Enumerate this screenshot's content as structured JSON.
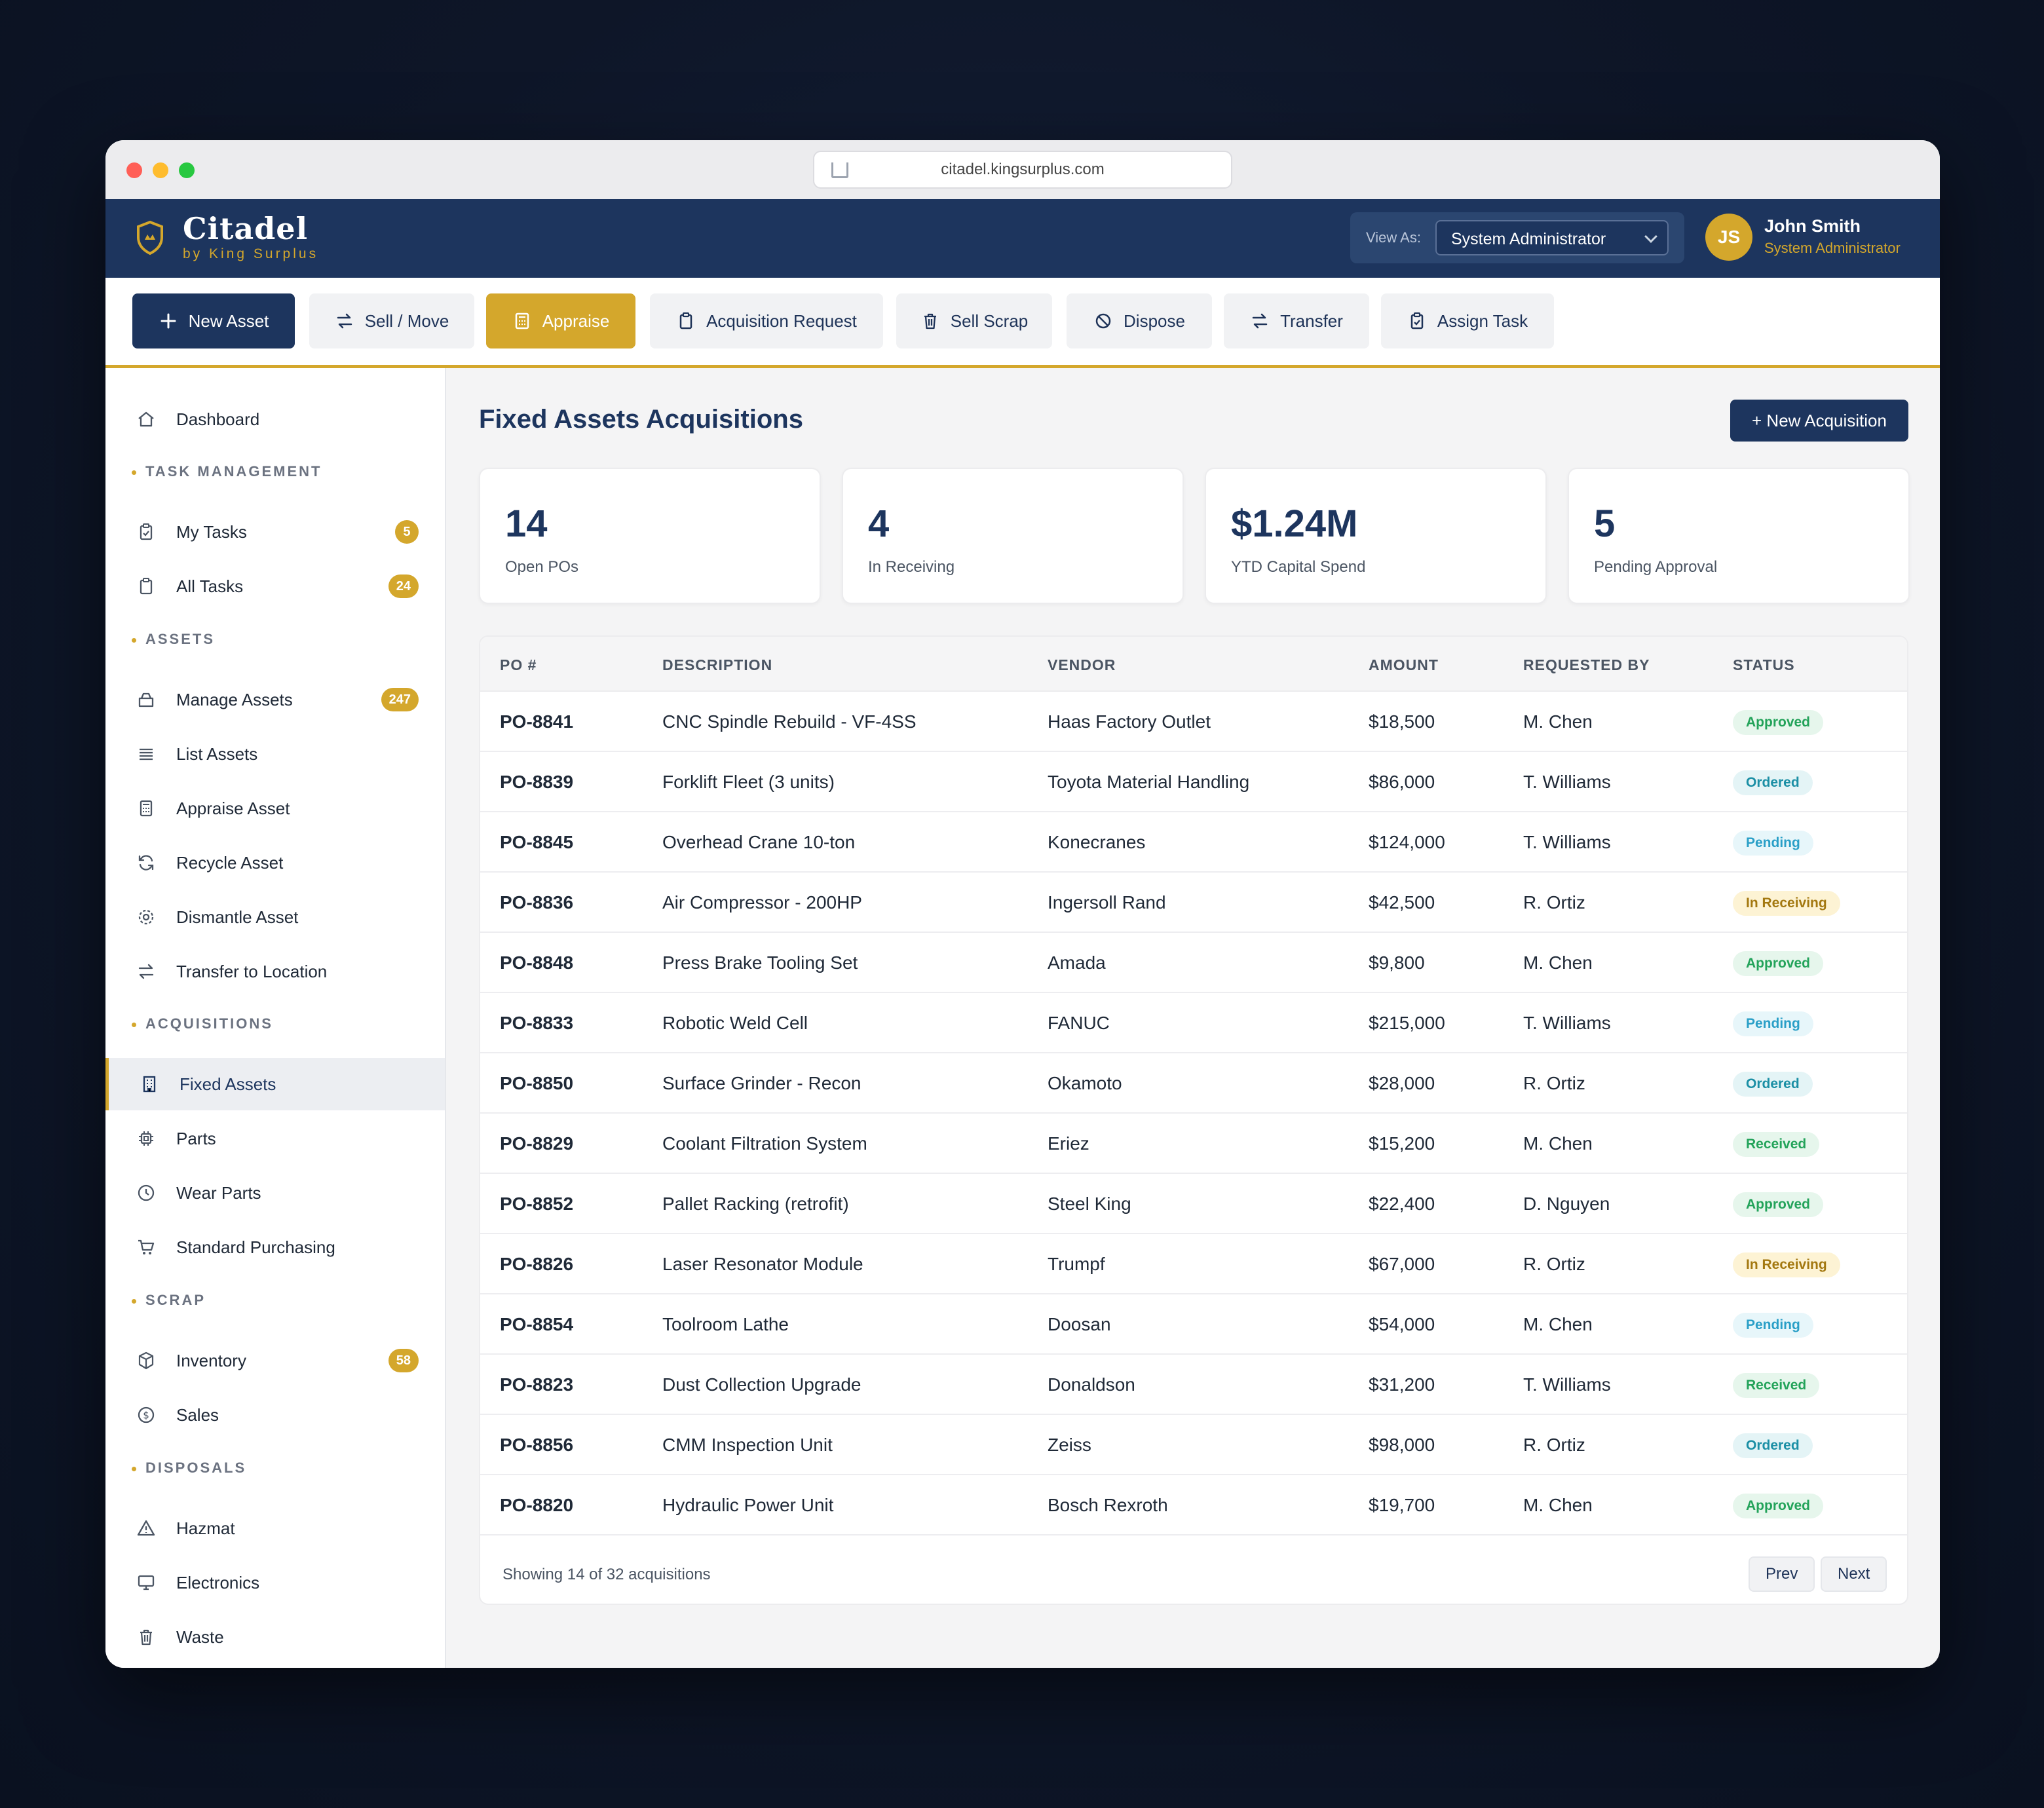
{
  "browser": {
    "url": "citadel.kingsurplus.com"
  },
  "header": {
    "brand": "Citadel",
    "brand_sub": "by King Surplus",
    "view_as_label": "View As:",
    "view_as_value": "System Administrator",
    "user_initials": "JS",
    "user_name": "John Smith",
    "user_role": "System Administrator"
  },
  "toolbar": {
    "new_asset": "New Asset",
    "sell_move": "Sell / Move",
    "appraise": "Appraise",
    "acquisition_request": "Acquisition Request",
    "sell_scrap": "Sell Scrap",
    "dispose": "Dispose",
    "transfer": "Transfer",
    "assign_task": "Assign Task"
  },
  "sidebar": {
    "dashboard": "Dashboard",
    "sections": {
      "task_management": "TASK MANAGEMENT",
      "assets": "ASSETS",
      "acquisitions": "ACQUISITIONS",
      "scrap": "SCRAP",
      "disposals": "DISPOSALS"
    },
    "items": {
      "my_tasks": {
        "label": "My Tasks",
        "badge": "5"
      },
      "all_tasks": {
        "label": "All Tasks",
        "badge": "24"
      },
      "manage_assets": {
        "label": "Manage Assets",
        "badge": "247"
      },
      "list_assets": {
        "label": "List Assets"
      },
      "appraise_asset": {
        "label": "Appraise Asset"
      },
      "recycle_asset": {
        "label": "Recycle Asset"
      },
      "dismantle_asset": {
        "label": "Dismantle Asset"
      },
      "transfer_to_location": {
        "label": "Transfer to Location"
      },
      "fixed_assets": {
        "label": "Fixed Assets"
      },
      "parts": {
        "label": "Parts"
      },
      "wear_parts": {
        "label": "Wear Parts"
      },
      "standard_purchasing": {
        "label": "Standard Purchasing"
      },
      "inventory": {
        "label": "Inventory",
        "badge": "58"
      },
      "sales": {
        "label": "Sales"
      },
      "hazmat": {
        "label": "Hazmat"
      },
      "electronics": {
        "label": "Electronics"
      },
      "waste": {
        "label": "Waste"
      }
    }
  },
  "main": {
    "title": "Fixed Assets Acquisitions",
    "new_button": "+ New Acquisition",
    "stats": [
      {
        "value": "14",
        "label": "Open POs"
      },
      {
        "value": "4",
        "label": "In Receiving"
      },
      {
        "value": "$1.24M",
        "label": "YTD Capital Spend"
      },
      {
        "value": "5",
        "label": "Pending Approval"
      }
    ],
    "table": {
      "columns": [
        "PO #",
        "DESCRIPTION",
        "VENDOR",
        "AMOUNT",
        "REQUESTED BY",
        "STATUS"
      ],
      "rows": [
        {
          "po": "PO-8841",
          "description": "CNC Spindle Rebuild - VF-4SS",
          "vendor": "Haas Factory Outlet",
          "amount": "$18,500",
          "requested_by": "M. Chen",
          "status": "Approved"
        },
        {
          "po": "PO-8839",
          "description": "Forklift Fleet (3 units)",
          "vendor": "Toyota Material Handling",
          "amount": "$86,000",
          "requested_by": "T. Williams",
          "status": "Ordered"
        },
        {
          "po": "PO-8845",
          "description": "Overhead Crane 10-ton",
          "vendor": "Konecranes",
          "amount": "$124,000",
          "requested_by": "T. Williams",
          "status": "Pending"
        },
        {
          "po": "PO-8836",
          "description": "Air Compressor - 200HP",
          "vendor": "Ingersoll Rand",
          "amount": "$42,500",
          "requested_by": "R. Ortiz",
          "status": "In Receiving"
        },
        {
          "po": "PO-8848",
          "description": "Press Brake Tooling Set",
          "vendor": "Amada",
          "amount": "$9,800",
          "requested_by": "M. Chen",
          "status": "Approved"
        },
        {
          "po": "PO-8833",
          "description": "Robotic Weld Cell",
          "vendor": "FANUC",
          "amount": "$215,000",
          "requested_by": "T. Williams",
          "status": "Pending"
        },
        {
          "po": "PO-8850",
          "description": "Surface Grinder - Recon",
          "vendor": "Okamoto",
          "amount": "$28,000",
          "requested_by": "R. Ortiz",
          "status": "Ordered"
        },
        {
          "po": "PO-8829",
          "description": "Coolant Filtration System",
          "vendor": "Eriez",
          "amount": "$15,200",
          "requested_by": "M. Chen",
          "status": "Received"
        },
        {
          "po": "PO-8852",
          "description": "Pallet Racking (retrofit)",
          "vendor": "Steel King",
          "amount": "$22,400",
          "requested_by": "D. Nguyen",
          "status": "Approved"
        },
        {
          "po": "PO-8826",
          "description": "Laser Resonator Module",
          "vendor": "Trumpf",
          "amount": "$67,000",
          "requested_by": "R. Ortiz",
          "status": "In Receiving"
        },
        {
          "po": "PO-8854",
          "description": "Toolroom Lathe",
          "vendor": "Doosan",
          "amount": "$54,000",
          "requested_by": "M. Chen",
          "status": "Pending"
        },
        {
          "po": "PO-8823",
          "description": "Dust Collection Upgrade",
          "vendor": "Donaldson",
          "amount": "$31,200",
          "requested_by": "T. Williams",
          "status": "Received"
        },
        {
          "po": "PO-8856",
          "description": "CMM Inspection Unit",
          "vendor": "Zeiss",
          "amount": "$98,000",
          "requested_by": "R. Ortiz",
          "status": "Ordered"
        },
        {
          "po": "PO-8820",
          "description": "Hydraulic Power Unit",
          "vendor": "Bosch Rexroth",
          "amount": "$19,700",
          "requested_by": "M. Chen",
          "status": "Approved"
        }
      ],
      "footer_info": "Showing 14 of 32 acquisitions",
      "prev": "Prev",
      "next": "Next"
    }
  },
  "colors": {
    "navy": "#1d355e",
    "gold": "#d4a72c",
    "approved": "#23a35a",
    "ordered": "#1b8fa5",
    "pending": "#2a9fc7",
    "in_receiving": "#a37810"
  }
}
